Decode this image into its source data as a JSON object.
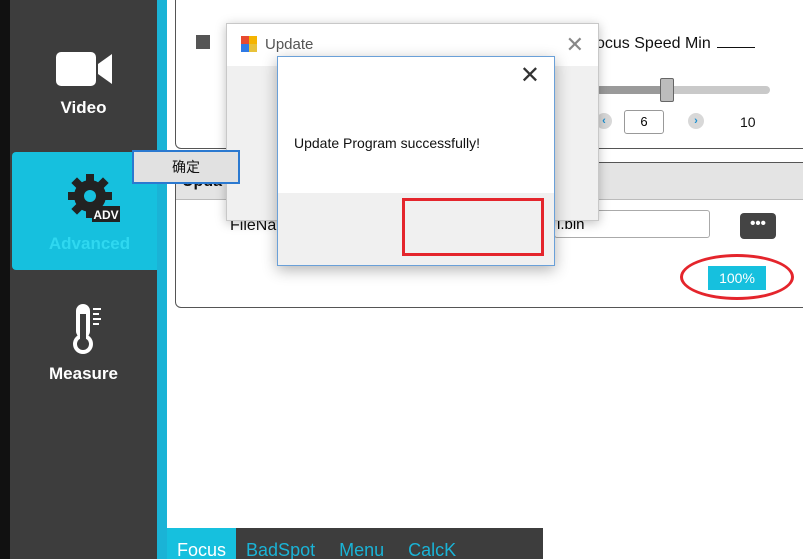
{
  "sidebar": {
    "items": [
      {
        "label": "Video",
        "icon": "video-camera-icon"
      },
      {
        "label": "Advanced",
        "icon": "gear-adv-icon",
        "badge": "ADV"
      },
      {
        "label": "Measure",
        "icon": "thermometer-icon"
      }
    ]
  },
  "focus": {
    "speed_min_label": "ocus Speed Min",
    "stepper_value": "6",
    "stepper_max": "10"
  },
  "update_panel": {
    "title": "Upda",
    "file_label": "FileNa",
    "file_value": "l.bin",
    "more_button": "•••",
    "progress": "100%"
  },
  "dialog_back": {
    "title": "Update"
  },
  "message_box": {
    "message": "Update Program successfully!",
    "ok_label": "确定"
  },
  "tabs": [
    "Focus",
    "BadSpot",
    "Menu",
    "CalcK"
  ],
  "colors": {
    "accent": "#16c0de",
    "sidebar": "#3d3d3d",
    "highlight_red": "#e4252c"
  }
}
